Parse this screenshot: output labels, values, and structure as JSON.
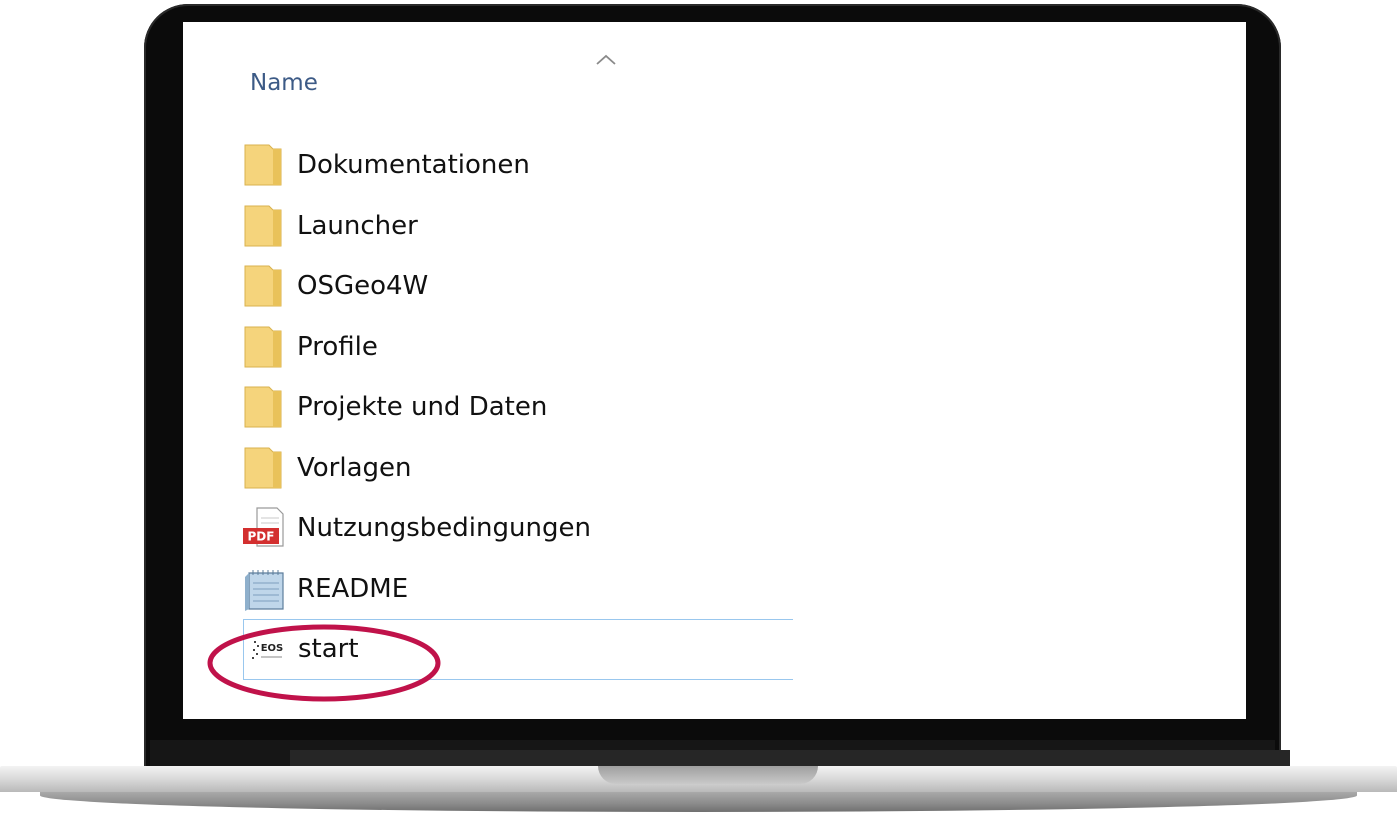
{
  "explorer": {
    "column_header": "Name",
    "sort_indicator": "chevron-up-icon",
    "items": [
      {
        "label": "Dokumentationen",
        "icon": "folder-icon"
      },
      {
        "label": "Launcher",
        "icon": "folder-icon"
      },
      {
        "label": "OSGeo4W",
        "icon": "folder-icon"
      },
      {
        "label": "Profile",
        "icon": "folder-icon"
      },
      {
        "label": "Projekte und Daten",
        "icon": "folder-icon"
      },
      {
        "label": "Vorlagen",
        "icon": "folder-icon"
      },
      {
        "label": "Nutzungsbedingungen",
        "icon": "pdf-file-icon",
        "icon_text": "PDF"
      },
      {
        "label": "README",
        "icon": "text-file-icon"
      },
      {
        "label": "start",
        "icon": "application-icon",
        "icon_text": "EOS",
        "selected": true
      }
    ]
  },
  "colors": {
    "header_text": "#3c5a86",
    "folder": "#f5d47c",
    "pdf_red": "#d32f2f",
    "selection_border": "#99c7ee",
    "highlight_ring": "#c0124a"
  }
}
